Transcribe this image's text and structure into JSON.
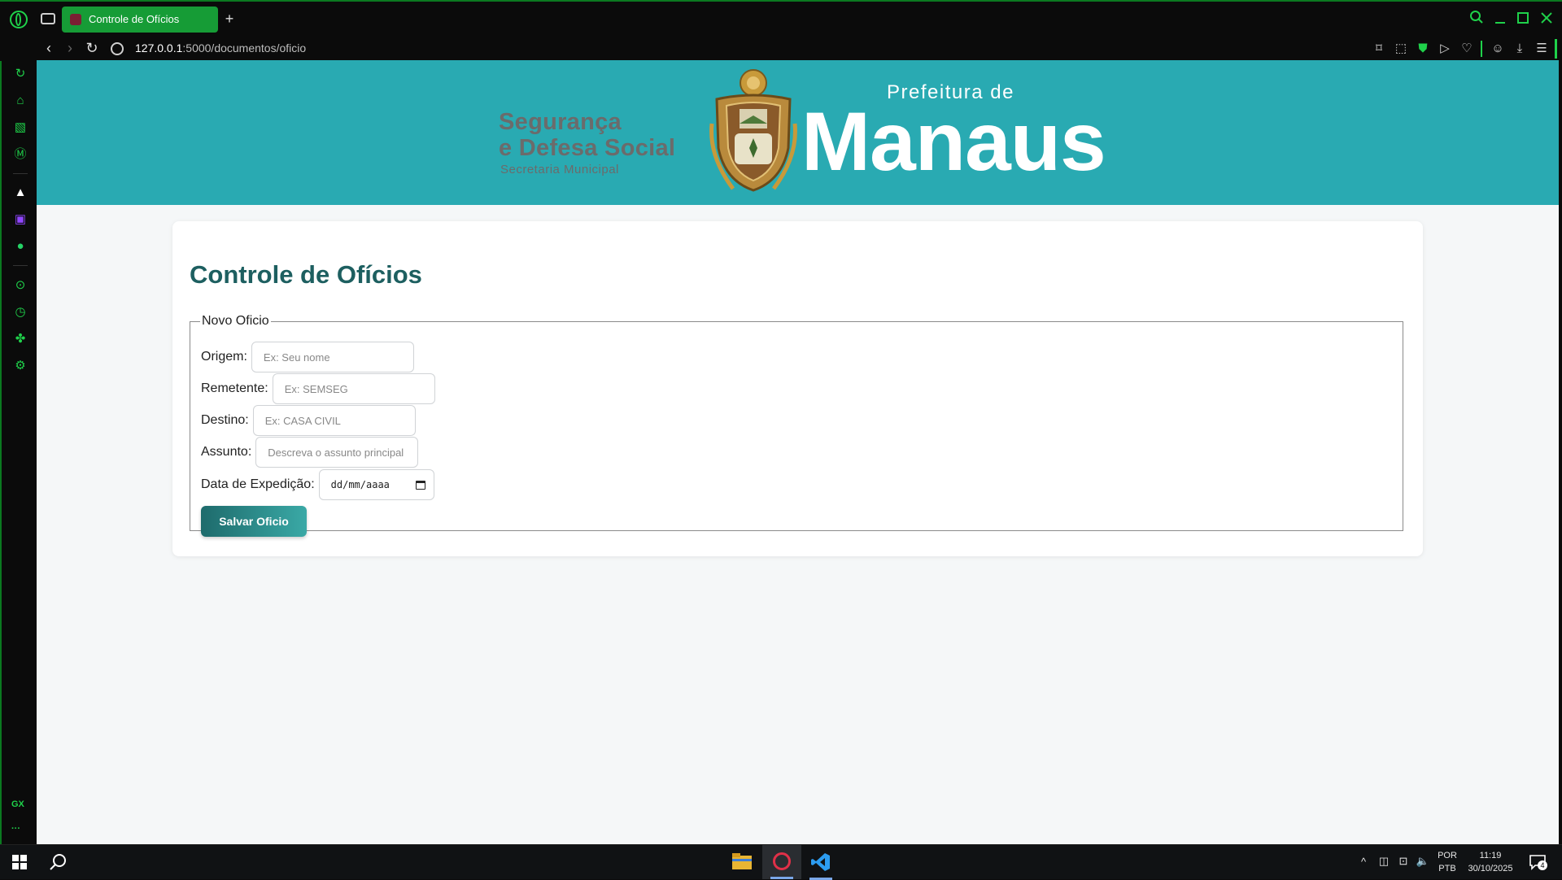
{
  "browser": {
    "tab_title": "Controle de Ofícios",
    "new_tab": "+",
    "url_host": "127.0.0.1",
    "url_rest": ":5000/documentos/oficio"
  },
  "sidebar": {
    "gx_label": "GX",
    "more_label": "···"
  },
  "banner": {
    "seg_line1": "Segurança",
    "seg_line2": "e Defesa Social",
    "seg_sub": "Secretaria Municipal",
    "pref_de": "Prefeitura de",
    "manaus": "Manaus"
  },
  "page": {
    "title": "Controle de Ofícios",
    "legend": "Novo Oficio",
    "fields": {
      "origem": {
        "label": "Origem:",
        "placeholder": "Ex: Seu nome"
      },
      "remetente": {
        "label": "Remetente:",
        "placeholder": "Ex: SEMSEG"
      },
      "destino": {
        "label": "Destino:",
        "placeholder": "Ex: CASA CIVIL"
      },
      "assunto": {
        "label": "Assunto:",
        "placeholder": "Descreva o assunto principal"
      },
      "data": {
        "label": "Data de Expedição:",
        "placeholder": "dd/mm/aaaa"
      }
    },
    "save_label": "Salvar Oficio"
  },
  "taskbar": {
    "lang1": "POR",
    "lang2": "PTB",
    "time": "11:19",
    "date": "30/10/2025",
    "notif_count": "4"
  },
  "colors": {
    "accent": "#1fd14a",
    "banner": "#29aab2",
    "title": "#1d5f60"
  }
}
